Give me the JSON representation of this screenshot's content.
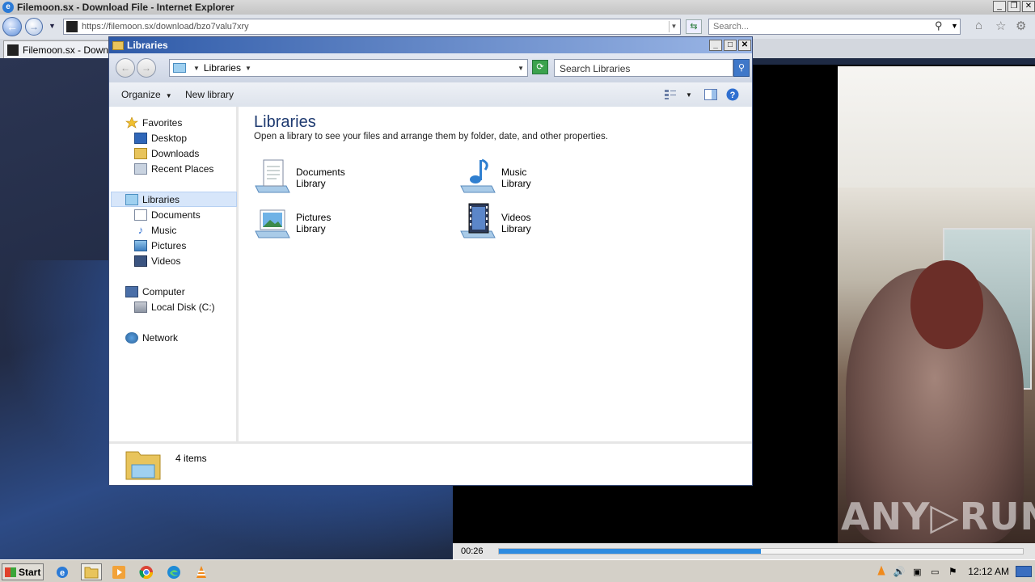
{
  "ie": {
    "title": "Filemoon.sx - Download File - Internet Explorer",
    "url": "https://filemoon.sx/download/bzo7valu7xry",
    "search_placeholder": "Search...",
    "tab_label": "Filemoon.sx - Downloa",
    "window_buttons": [
      "_",
      "❐",
      "✕"
    ]
  },
  "video": {
    "time": "00:26",
    "progress": 0.5,
    "watermark": "ANY▷RUN"
  },
  "explorer": {
    "title": "Libraries",
    "address_label": "Libraries",
    "search_placeholder": "Search Libraries",
    "commands": {
      "organize": "Organize",
      "new_library": "New library"
    },
    "nav": {
      "favorites": "Favorites",
      "desktop": "Desktop",
      "downloads": "Downloads",
      "recent": "Recent Places",
      "libraries": "Libraries",
      "documents": "Documents",
      "music": "Music",
      "pictures": "Pictures",
      "videos": "Videos",
      "computer": "Computer",
      "local_disk": "Local Disk (C:)",
      "network": "Network"
    },
    "heading": "Libraries",
    "subheading": "Open a library to see your files and arrange them by folder, date, and other properties.",
    "libraries": [
      {
        "name": "Documents",
        "type": "Library"
      },
      {
        "name": "Music",
        "type": "Library"
      },
      {
        "name": "Pictures",
        "type": "Library"
      },
      {
        "name": "Videos",
        "type": "Library"
      }
    ],
    "status": "4 items"
  },
  "taskbar": {
    "start": "Start",
    "clock": "12:12 AM"
  }
}
